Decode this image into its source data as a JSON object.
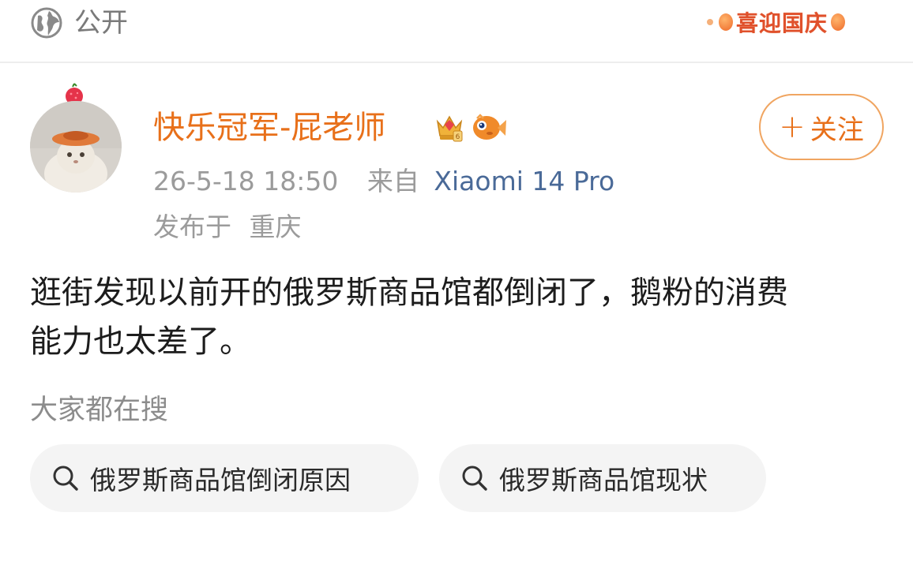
{
  "header": {
    "visibility_label": "公开",
    "festival_banner": "喜迎国庆"
  },
  "post": {
    "author": "快乐冠军-屁老师",
    "follow_label": "关注",
    "follow_plus": "+",
    "timestamp": "26-5-18 18:50",
    "source_prefix": "来自",
    "device": "Xiaomi 14 Pro",
    "location_prefix": "发布于",
    "location": "重庆",
    "body_lines": [
      "逛街发现以前开的俄罗斯商品馆都倒闭了，鹅粉的消费",
      "能力也太差了。"
    ]
  },
  "search": {
    "heading": "大家都在搜",
    "suggestions": [
      "俄罗斯商品馆倒闭原因",
      "俄罗斯商品馆现状"
    ]
  },
  "colors": {
    "accent_orange": "#e8701a",
    "follow_border": "#f0a561",
    "device_blue": "#4a6a98",
    "muted_gray": "#9b9b9b",
    "chip_bg": "#f4f4f4"
  },
  "icons": {
    "visibility": "globe-icon",
    "vip_badge": "crown-vip-icon",
    "fan_badge": "fish-badge-icon",
    "search": "search-icon",
    "avatar_decoration": "lychee-icon"
  }
}
